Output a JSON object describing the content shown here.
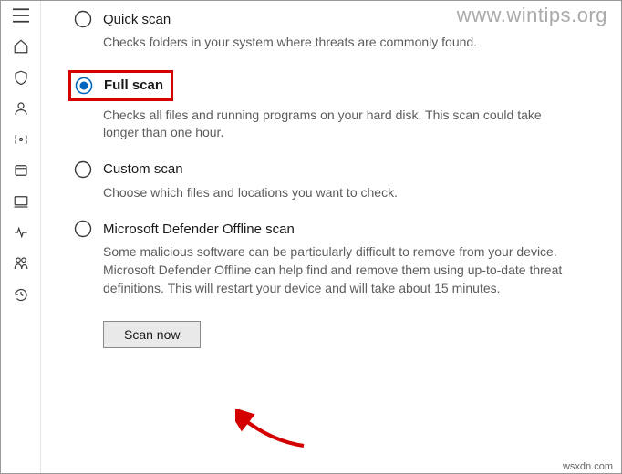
{
  "watermark": "www.wintips.org",
  "attribution": "wsxdn.com",
  "options": {
    "quick": {
      "label": "Quick scan",
      "desc": "Checks folders in your system where threats are commonly found."
    },
    "full": {
      "label": "Full scan",
      "desc": "Checks all files and running programs on your hard disk. This scan could take longer than one hour."
    },
    "custom": {
      "label": "Custom scan",
      "desc": "Choose which files and locations you want to check."
    },
    "offline": {
      "label": "Microsoft Defender Offline scan",
      "desc": "Some malicious software can be particularly difficult to remove from your device. Microsoft Defender Offline can help find and remove them using up-to-date threat definitions. This will restart your device and will take about 15 minutes."
    }
  },
  "scan_button": "Scan now"
}
